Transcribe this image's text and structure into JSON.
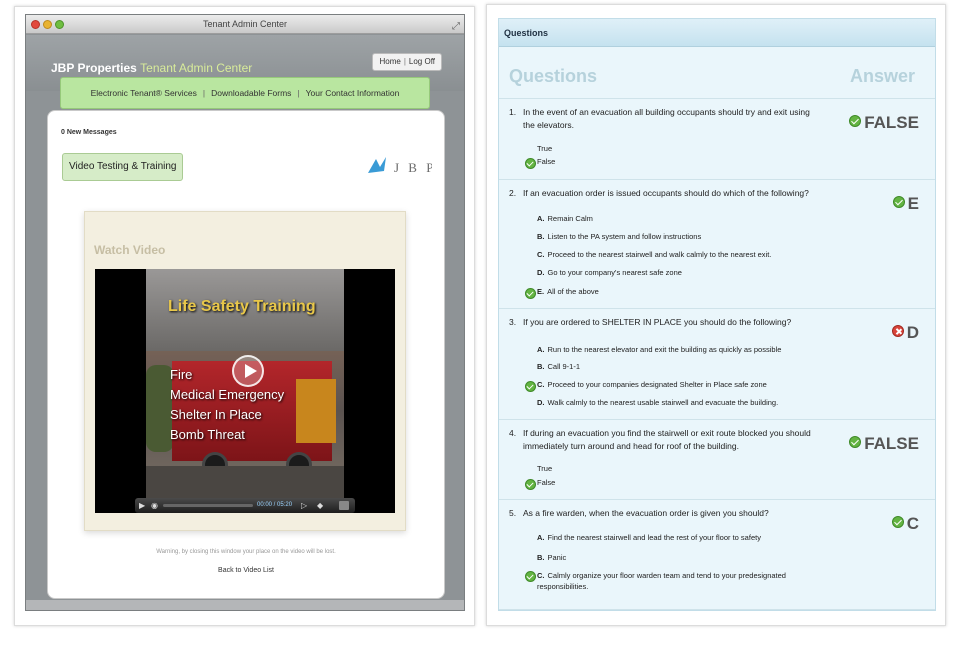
{
  "window": {
    "title": "Tenant Admin Center",
    "brand": "JBP Properties",
    "brand_sub": "Tenant Admin Center",
    "links": [
      "Home",
      "Log Off"
    ]
  },
  "nav": {
    "items": [
      "Electronic Tenant® Services",
      "Downloadable Forms",
      "Your Contact Information"
    ]
  },
  "messages": {
    "label": "0 New Messages"
  },
  "tab": {
    "label": "Video Testing & Training"
  },
  "logo": {
    "text": "J B P"
  },
  "video": {
    "heading": "Watch Video",
    "frame_title": "Life Safety Training",
    "frame_lines": [
      "Fire",
      "Medical Emergency",
      "Shelter In Place",
      "Bomb Threat"
    ],
    "time": "00:00 / 05:20",
    "warning": "Warning, by closing this window your place on the video will be lost.",
    "back_link": "Back to Video List"
  },
  "quiz": {
    "panel_title": "Questions",
    "col_questions": "Questions",
    "col_answer": "Answer",
    "questions": [
      {
        "num": "1.",
        "text": "In the event of an evacuation all building occupants should try and exit using the elevators.",
        "options": [
          {
            "letter": "",
            "text": "True",
            "checked": false
          },
          {
            "letter": "",
            "text": "False",
            "checked": true
          }
        ],
        "answer": "FALSE",
        "status": "correct"
      },
      {
        "num": "2.",
        "text": "If an evacuation order is issued occupants should do which of the following?",
        "options": [
          {
            "letter": "A.",
            "text": "Remain Calm",
            "checked": false
          },
          {
            "letter": "B.",
            "text": "Listen to the PA system and follow instructions",
            "checked": false
          },
          {
            "letter": "C.",
            "text": "Proceed to the nearest stairwell and walk calmly to the nearest exit.",
            "checked": false
          },
          {
            "letter": "D.",
            "text": "Go to your company's nearest safe zone",
            "checked": false
          },
          {
            "letter": "E.",
            "text": "All of the above",
            "checked": true
          }
        ],
        "answer": "E",
        "status": "correct"
      },
      {
        "num": "3.",
        "text": "If you are ordered to SHELTER IN PLACE you should do the following?",
        "options": [
          {
            "letter": "A.",
            "text": "Run to the nearest elevator and exit the building as quickly as possible",
            "checked": false
          },
          {
            "letter": "B.",
            "text": "Call 9-1-1",
            "checked": false
          },
          {
            "letter": "C.",
            "text": "Proceed to your companies designated Shelter in Place safe zone",
            "checked": true
          },
          {
            "letter": "D.",
            "text": "Walk calmly to the nearest usable stairwell and evacuate the building.",
            "checked": false
          }
        ],
        "answer": "D",
        "status": "wrong"
      },
      {
        "num": "4.",
        "text": "If during an evacuation you find the stairwell or exit route blocked you should immediately turn around and head for roof of the building.",
        "options": [
          {
            "letter": "",
            "text": "True",
            "checked": false
          },
          {
            "letter": "",
            "text": "False",
            "checked": true
          }
        ],
        "answer": "FALSE",
        "status": "correct"
      },
      {
        "num": "5.",
        "text": "As a fire warden, when the evacuation order is given you should?",
        "options": [
          {
            "letter": "A.",
            "text": "Find the nearest stairwell and lead the rest of your floor to safety",
            "checked": false
          },
          {
            "letter": "B.",
            "text": "Panic",
            "checked": false
          },
          {
            "letter": "C.",
            "text": "Calmly organize your floor warden team and tend to your predesignated responsibilities.",
            "checked": true
          }
        ],
        "answer": "C",
        "status": "correct"
      }
    ]
  },
  "colors": {
    "nav_green": "#b9e6a0",
    "panel_blue": "#eaf6fb",
    "correct_green": "#63b442",
    "wrong_red": "#d9443a",
    "title_yellow": "#e8c74a"
  }
}
